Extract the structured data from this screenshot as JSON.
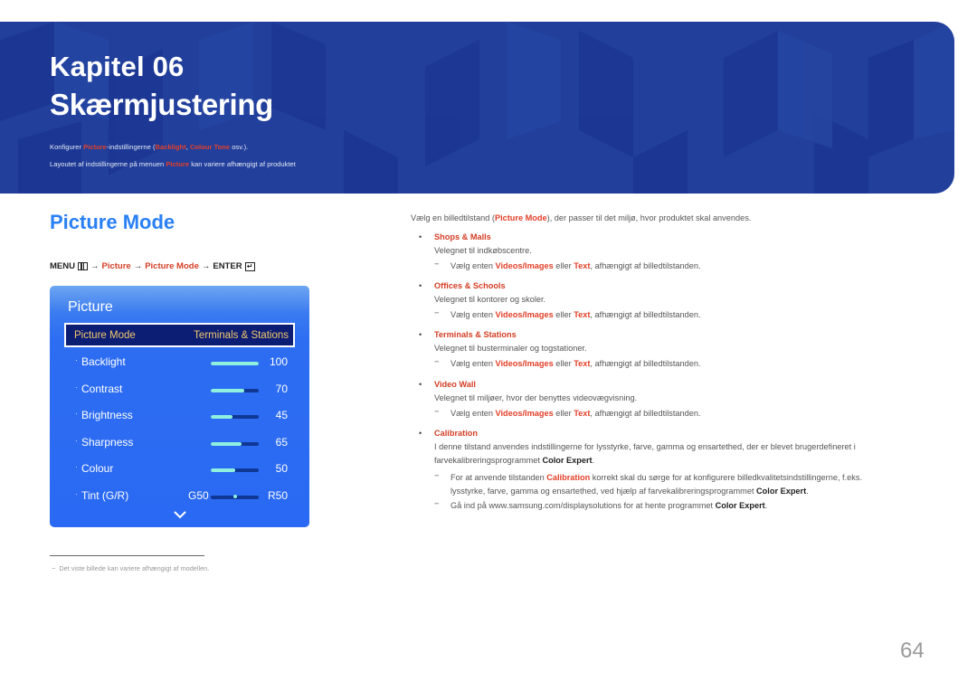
{
  "banner": {
    "chapter": "Kapitel 06",
    "title": "Skærmjustering",
    "line1": {
      "pre": "Konfigurer ",
      "picture": "Picture",
      "mid": "-indstillingerne (",
      "backlight": "Backlight",
      "comma": ", ",
      "colour_tone": "Colour Tone",
      "post": " osv.)."
    },
    "line2": {
      "pre": "Layoutet af indstillingerne på menuen ",
      "picture": "Picture",
      "post": " kan variere afhængigt af produktet"
    },
    "colors": {
      "background": "#213f9b",
      "highlight": "#e2402a"
    }
  },
  "section": {
    "title": "Picture Mode",
    "title_color": "#2a80f5"
  },
  "menu_path": {
    "menu": "MENU",
    "menu_icon": "menu-grid-icon",
    "arrow": "→",
    "step1": "Picture",
    "step2": "Picture Mode",
    "enter": "ENTER",
    "enter_icon": "enter-icon"
  },
  "osd": {
    "title": "Picture",
    "selected": {
      "label": "Picture Mode",
      "value": "Terminals & Stations"
    },
    "rows": [
      {
        "label": "Backlight",
        "value": "100",
        "level": 100
      },
      {
        "label": "Contrast",
        "value": "70",
        "level": 70
      },
      {
        "label": "Brightness",
        "value": "45",
        "level": 45
      },
      {
        "label": "Sharpness",
        "value": "65",
        "level": 65
      },
      {
        "label": "Colour",
        "value": "50",
        "level": 50
      }
    ],
    "tint": {
      "label": "Tint (G/R)",
      "left": "G50",
      "right": "R50",
      "level": 50
    },
    "more_icon": "chevron-down-icon"
  },
  "footnote": {
    "dash": "−",
    "text": "Det viste billede kan variere afhængigt af modellen."
  },
  "content": {
    "intro": {
      "pre": "Vælg en billedtilstand (",
      "term": "Picture Mode",
      "post": "), der passer til det miljø, hvor produktet skal anvendes."
    },
    "note_common": {
      "pre": "Vælg enten ",
      "a": "Videos/Images",
      "mid": " eller ",
      "b": "Text",
      "post": ", afhængigt af billedtilstanden."
    },
    "items": [
      {
        "name": "Shops & Malls",
        "desc": "Velegnet til indkøbscentre."
      },
      {
        "name": "Offices & Schools",
        "desc": "Velegnet til kontorer og skoler."
      },
      {
        "name": "Terminals & Stations",
        "desc": "Velegnet til busterminaler og togstationer."
      },
      {
        "name": "Video Wall",
        "desc": "Velegnet til miljøer, hvor der benyttes videovægvisning."
      }
    ],
    "calibration": {
      "name": "Calibration",
      "desc1": "I denne tilstand anvendes indstillingerne for lysstyrke, farve, gamma og ensartethed, der er blevet brugerdefineret i",
      "desc2_pre": "farvekalibreringsprogrammet ",
      "desc2_bold": "Color Expert",
      "desc2_post": ".",
      "note1_pre": "For at anvende tilstanden ",
      "note1_term": "Calibration",
      "note1_post": " korrekt skal du sørge for at konfigurere billedkvalitetsindstillingerne, f.eks.",
      "note1_line2_pre": "lysstyrke, farve, gamma og ensartethed, ved hjælp af farvekalibreringsprogrammet ",
      "note1_line2_bold": "Color Expert",
      "note1_line2_post": ".",
      "note2_pre": "Gå ind på www.samsung.com/displaysolutions for at hente programmet ",
      "note2_bold": "Color Expert",
      "note2_post": "."
    },
    "bullet": "•",
    "dash": "−"
  },
  "page_number": "64"
}
